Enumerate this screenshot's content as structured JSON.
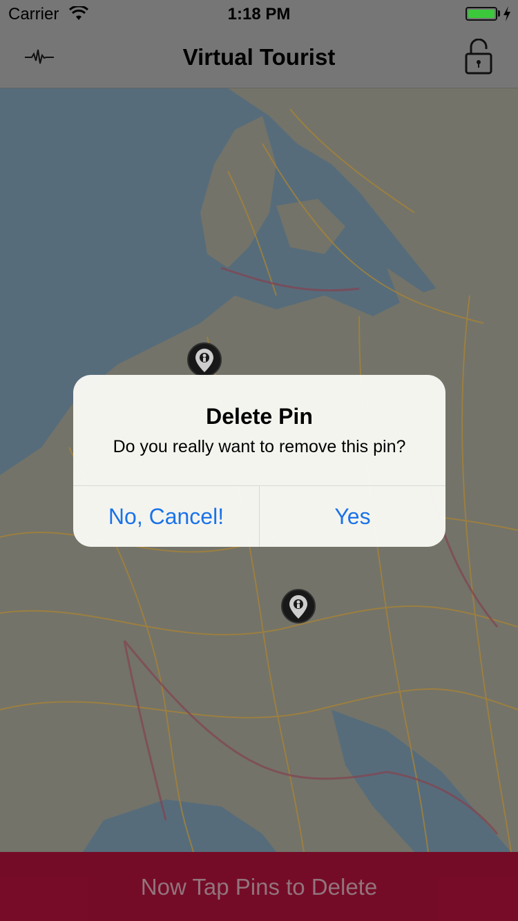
{
  "status_bar": {
    "carrier": "Carrier",
    "time": "1:18 PM",
    "wifi_icon": "wifi-icon",
    "battery_icon": "battery-icon",
    "charging_icon": "charging-bolt-icon"
  },
  "nav_bar": {
    "title": "Virtual Tourist",
    "left_icon": "activity-pulse-icon",
    "right_icon": "unlock-icon"
  },
  "map": {
    "pins": [
      "map-pin-icon",
      "map-pin-icon"
    ],
    "colors": {
      "water": "#5b7282",
      "land": "#7a7a6f",
      "roads": "#b08a3a",
      "borders": "#8a4a56"
    }
  },
  "alert": {
    "title": "Delete Pin",
    "message": "Do you really want to remove this pin?",
    "cancel_label": "No, Cancel!",
    "confirm_label": "Yes"
  },
  "bottom_banner": {
    "label": "Now Tap Pins to Delete",
    "background": "#7c0d2a"
  }
}
